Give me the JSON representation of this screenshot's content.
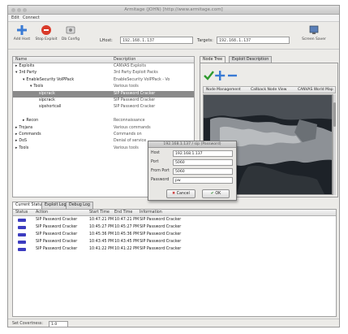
{
  "window": {
    "title": "Armitage (JOHN) [http://www.armitage.com]"
  },
  "menu": {
    "items": [
      "Edit",
      "Connect"
    ]
  },
  "toolbar": {
    "buttons": [
      {
        "label": "Add Host",
        "icon": "plus-icon"
      },
      {
        "label": "Stop Exploit",
        "icon": "stop-icon"
      },
      {
        "label": "Db Config",
        "icon": "config-icon"
      },
      {
        "label": "Screen Saver",
        "icon": "screen-icon"
      }
    ],
    "lhost_label": "LHost:",
    "lhost_value": "192.168.1.137",
    "target_label": "Targets:",
    "target_value": "192.168.1.137"
  },
  "tree": {
    "headers": [
      "Name",
      "Description"
    ],
    "rows": [
      {
        "name": "Exploits",
        "desc": "CANVAS Exploits",
        "indent": 0,
        "exp": "▸"
      },
      {
        "name": "3rd Party",
        "desc": "3rd Party Exploit Packs",
        "indent": 0,
        "exp": "▾"
      },
      {
        "name": "EnableSecurity VoIPPack",
        "desc": "EnableSecurity VoIPPack - Vo",
        "indent": 1,
        "exp": "▾"
      },
      {
        "name": "Tools",
        "desc": "Various tools",
        "indent": 2,
        "exp": "▾"
      },
      {
        "name": "sipcrack",
        "desc": "SIP Password Cracker",
        "indent": 3,
        "exp": "",
        "selected": true
      },
      {
        "name": "sipcrack",
        "desc": "SIP Password Cracker",
        "indent": 3,
        "exp": ""
      },
      {
        "name": "sipshortcall",
        "desc": "SIP Password Cracker",
        "indent": 3,
        "exp": ""
      },
      {
        "name": "",
        "desc": "",
        "indent": 3,
        "exp": ""
      },
      {
        "name": "Recon",
        "desc": "Reconnaissance",
        "indent": 1,
        "exp": "▸"
      },
      {
        "name": "Trojans",
        "desc": "Various commands",
        "indent": 0,
        "exp": "▸"
      },
      {
        "name": "Commands",
        "desc": "Commands on",
        "indent": 0,
        "exp": "▸"
      },
      {
        "name": "DoS",
        "desc": "Denial of service",
        "indent": 0,
        "exp": "▸"
      },
      {
        "name": "Tools",
        "desc": "Various tools",
        "indent": 0,
        "exp": "▸"
      }
    ]
  },
  "right_panel": {
    "tabs": [
      "Node Tree",
      "Exploit Description"
    ],
    "headers": [
      "Node Management",
      "Callback Node View",
      "CANVAS World Map"
    ]
  },
  "dialog": {
    "title": "192.168.1.137 / sip (Password)",
    "fields": [
      {
        "label": "Host",
        "value": "192.168.1.137"
      },
      {
        "label": "Port",
        "value": "5060"
      },
      {
        "label": "From Port",
        "value": "5060"
      },
      {
        "label": "Password",
        "value": "pw"
      }
    ],
    "cancel_label": "Cancel",
    "ok_label": "OK"
  },
  "bottom": {
    "tabs": [
      "Current Status",
      "Exploit Log",
      "Debug Log"
    ],
    "headers": [
      "Status",
      "Action",
      "Start Time",
      "End Time",
      "Information"
    ],
    "rows": [
      {
        "action": "SIP Password Cracker",
        "start": "10:47:21 PM",
        "end": "10:47:21 PM",
        "info": "SIP Password Cracker"
      },
      {
        "action": "SIP Password Cracker",
        "start": "10:45:27 PM",
        "end": "10:45:27 PM",
        "info": "SIP Password Cracker"
      },
      {
        "action": "SIP Password Cracker",
        "start": "10:45:36 PM",
        "end": "10:45:36 PM",
        "info": "SIP Password Cracker"
      },
      {
        "action": "SIP Password Cracker",
        "start": "10:43:45 PM",
        "end": "10:43:45 PM",
        "info": "SIP Password Cracker"
      },
      {
        "action": "SIP Password Cracker",
        "start": "10:41:22 PM",
        "end": "10:41:22 PM",
        "info": "SIP Password Cracker"
      }
    ]
  },
  "statusbar": {
    "label": "Set Covertness:",
    "value": "1.0"
  }
}
